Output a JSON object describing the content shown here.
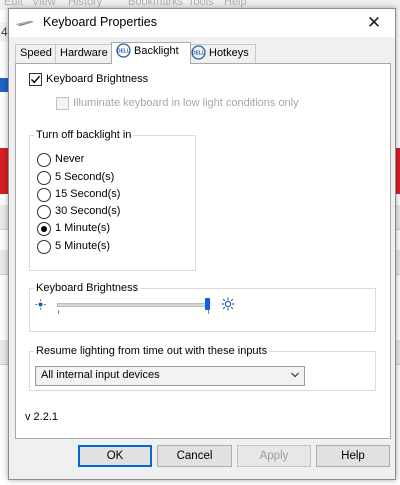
{
  "background_app": {
    "menu": [
      "Edit",
      "View",
      "History",
      "Bookmarks",
      "Tools",
      "Help"
    ],
    "digit": "4"
  },
  "dialog": {
    "title": "Keyboard Properties",
    "close_glyph": "✕",
    "tabs": [
      {
        "label": "Speed"
      },
      {
        "label": "Hardware"
      },
      {
        "label": "Backlight",
        "active": true,
        "icon": "dell-logo-icon"
      },
      {
        "label": "Hotkeys",
        "icon": "dell-logo-icon"
      }
    ],
    "backlight": {
      "keyboard_brightness_checkbox": {
        "label": "Keyboard Brightness",
        "checked": true
      },
      "illuminate_checkbox": {
        "label": "Illuminate keyboard in low light conditions only",
        "checked": false,
        "enabled": false
      },
      "timeout_group": {
        "title": "Turn off backlight in",
        "options": [
          "Never",
          "5 Second(s)",
          "15 Second(s)",
          "30 Second(s)",
          "1 Minute(s)",
          "5 Minute(s)"
        ],
        "selected": "1 Minute(s)"
      },
      "brightness_group": {
        "title": "Keyboard Brightness",
        "level": 1.0,
        "low_icon": "dim-sun-icon",
        "high_icon": "bright-sun-icon"
      },
      "resume_group": {
        "title": "Resume lighting from time out with these inputs",
        "selected": "All internal input devices"
      },
      "version": "v 2.2.1"
    },
    "buttons": {
      "ok": "OK",
      "cancel": "Cancel",
      "apply": "Apply",
      "help": "Help"
    }
  },
  "colors": {
    "accent": "#0b64d6",
    "background_red": "#d61e25"
  }
}
